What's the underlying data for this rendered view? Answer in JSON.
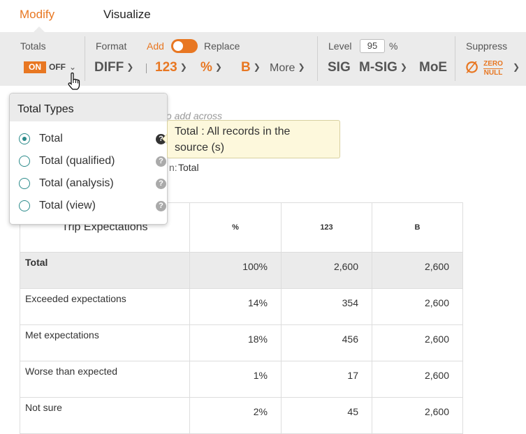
{
  "tabs": [
    {
      "label": "Modify",
      "active": true
    },
    {
      "label": "Visualize",
      "active": false
    }
  ],
  "toolbar": {
    "totals": {
      "label": "Totals",
      "on": "ON",
      "off": "OFF"
    },
    "format": {
      "label": "Format",
      "add": "Add",
      "replace": "Replace",
      "diff": "DIFF",
      "count": "123",
      "percent": "%",
      "base": "B",
      "more": "More"
    },
    "level": {
      "label": "Level",
      "value": "95",
      "unit": "%",
      "sig": "SIG",
      "msig": "M-SIG",
      "moe": "MoE"
    },
    "suppress": {
      "label": "Suppress",
      "zero": "ZERO",
      "null": "NULL"
    }
  },
  "background": {
    "hint": "to add across",
    "summary_prefix": "n:",
    "summary_value": "Total"
  },
  "table": {
    "headers": [
      "Trip Expectations",
      "%",
      "123",
      "B"
    ],
    "rows": [
      {
        "label": "Total",
        "pct": "100%",
        "count": "2,600",
        "base": "2,600"
      },
      {
        "label": "Exceeded expectations",
        "pct": "14%",
        "count": "354",
        "base": "2,600"
      },
      {
        "label": "Met expectations",
        "pct": "18%",
        "count": "456",
        "base": "2,600"
      },
      {
        "label": "Worse than expected",
        "pct": "1%",
        "count": "17",
        "base": "2,600"
      },
      {
        "label": "Not sure",
        "pct": "2%",
        "count": "45",
        "base": "2,600"
      }
    ]
  },
  "popup": {
    "title": "Total Types",
    "options": [
      {
        "label": "Total",
        "selected": true
      },
      {
        "label": "Total (qualified)",
        "selected": false
      },
      {
        "label": "Total (analysis)",
        "selected": false
      },
      {
        "label": "Total (view)",
        "selected": false
      }
    ],
    "help_glyph": "?"
  },
  "tooltip": {
    "line1": "Total : All records in the",
    "line2": "source (s)"
  },
  "colors": {
    "accent": "#e87722",
    "radio": "#2a8a8a",
    "toolbar_bg": "#ebebeb",
    "tooltip_bg": "#fdf8dc"
  }
}
